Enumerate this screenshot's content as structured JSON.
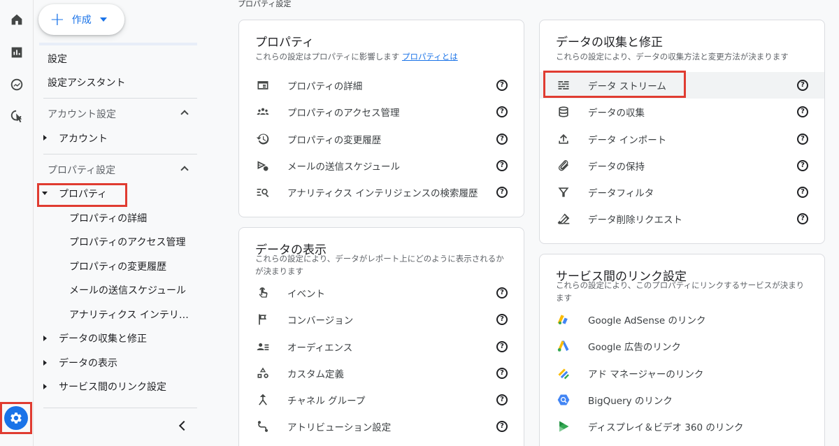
{
  "breadcrumb": "プロパティ設定",
  "create_button": {
    "label": "作成"
  },
  "sidenav": {
    "settings": "設定",
    "setup_assistant": "設定アシスタント",
    "account_settings_header": "アカウント設定",
    "account": "アカウント",
    "property_settings_header": "プロパティ設定",
    "property": "プロパティ",
    "property_subitems": [
      "プロパティの詳細",
      "プロパティのアクセス管理",
      "プロパティの変更履歴",
      "メールの送信スケジュール",
      "アナリティクス インテリジ…"
    ],
    "data_collection": "データの収集と修正",
    "data_display": "データの表示",
    "product_links": "サービス間のリンク設定"
  },
  "cards": {
    "property": {
      "title": "プロパティ",
      "desc": "これらの設定はプロパティに影響します",
      "desc_link": "プロパティとは",
      "items": [
        {
          "label": "プロパティの詳細",
          "icon": "property-details-icon"
        },
        {
          "label": "プロパティのアクセス管理",
          "icon": "people-icon"
        },
        {
          "label": "プロパティの変更履歴",
          "icon": "history-icon"
        },
        {
          "label": "メールの送信スケジュール",
          "icon": "scheduled-email-icon"
        },
        {
          "label": "アナリティクス インテリジェンスの検索履歴",
          "icon": "search-history-icon"
        }
      ]
    },
    "display": {
      "title": "データの表示",
      "desc": "これらの設定により、データがレポート上にどのように表示されるかが決まります",
      "items": [
        {
          "label": "イベント",
          "icon": "touch-icon"
        },
        {
          "label": "コンバージョン",
          "icon": "flag-icon"
        },
        {
          "label": "オーディエンス",
          "icon": "audience-icon"
        },
        {
          "label": "カスタム定義",
          "icon": "shapes-icon"
        },
        {
          "label": "チャネル グループ",
          "icon": "merge-icon"
        },
        {
          "label": "アトリビューション設定",
          "icon": "attribution-icon"
        }
      ]
    },
    "collection": {
      "title": "データの収集と修正",
      "desc": "これらの設定により、データの収集方法と変更方法が決まります",
      "items": [
        {
          "label": "データ ストリーム",
          "icon": "data-stream-icon"
        },
        {
          "label": "データの収集",
          "icon": "database-icon"
        },
        {
          "label": "データ インポート",
          "icon": "upload-icon"
        },
        {
          "label": "データの保持",
          "icon": "retention-icon"
        },
        {
          "label": "データフィルタ",
          "icon": "filter-icon"
        },
        {
          "label": "データ削除リクエスト",
          "icon": "eraser-icon"
        }
      ]
    },
    "links": {
      "title": "サービス間のリンク設定",
      "desc": "これらの設定により、このプロパティにリンクするサービスが決まります",
      "items": [
        {
          "label": "Google AdSense のリンク",
          "icon": "adsense-icon"
        },
        {
          "label": "Google 広告のリンク",
          "icon": "google-ads-icon"
        },
        {
          "label": "アド マネージャーのリンク",
          "icon": "ad-manager-icon"
        },
        {
          "label": "BigQuery のリンク",
          "icon": "bigquery-icon"
        },
        {
          "label": "ディスプレイ＆ビデオ 360 のリンク",
          "icon": "dv360-icon"
        }
      ]
    }
  },
  "colors": {
    "accent": "#1a73e8",
    "highlight": "#e03c31"
  }
}
